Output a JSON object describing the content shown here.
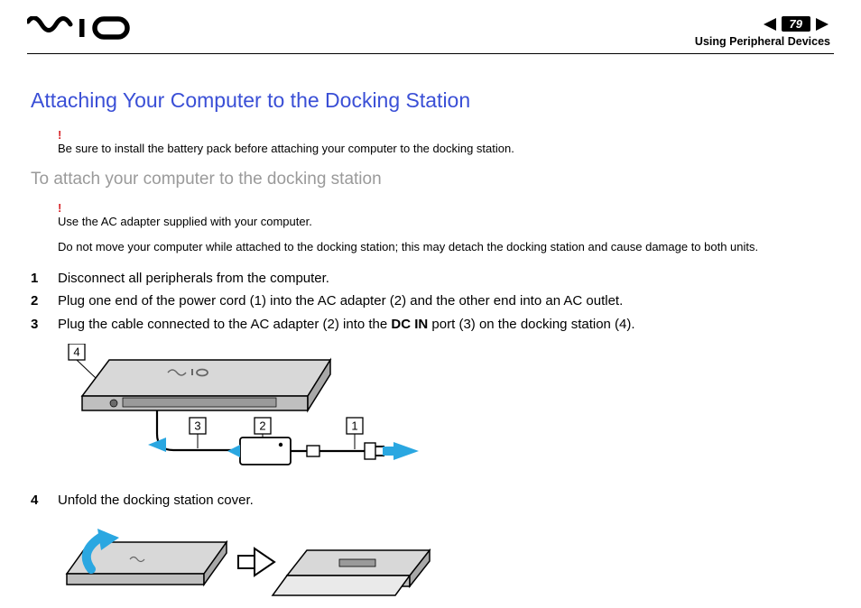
{
  "header": {
    "page_number": "79",
    "breadcrumb": "Using Peripheral Devices"
  },
  "title": "Attaching Your Computer to the Docking Station",
  "warnings": {
    "w1": "Be sure to install the battery pack before attaching your computer to the docking station.",
    "w2": "Use the AC adapter supplied with your computer.",
    "w3": "Do not move your computer while attached to the docking station; this may detach the docking station and cause damage to both units."
  },
  "subtitle": "To attach your computer to the docking station",
  "steps": {
    "s1": "Disconnect all peripherals from the computer.",
    "s2": "Plug one end of the power cord (1) into the AC adapter (2) and the other end into an AC outlet.",
    "s3_pre": "Plug the cable connected to the AC adapter (2) into the ",
    "s3_bold": "DC IN",
    "s3_post": " port (3) on the docking station (4).",
    "s4": "Unfold the docking station cover."
  },
  "callouts": {
    "c1": "1",
    "c2": "2",
    "c3": "3",
    "c4": "4"
  }
}
